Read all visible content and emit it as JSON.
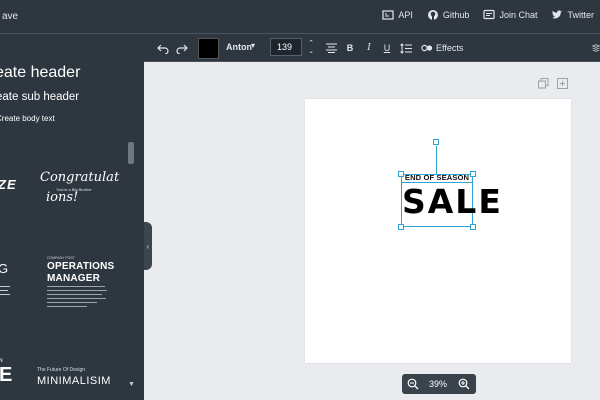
{
  "topbar": {
    "title_fragment": "ave",
    "links": [
      {
        "label": "API",
        "icon": "api-icon"
      },
      {
        "label": "Github",
        "icon": "github-icon"
      },
      {
        "label": "Join Chat",
        "icon": "chat-icon"
      },
      {
        "label": "Twitter",
        "icon": "twitter-icon"
      }
    ]
  },
  "sidebar": {
    "header_option": "eate header",
    "subheader_option": "eate sub header",
    "body_option": "Create body text",
    "templates": {
      "t1": "ZE",
      "t2_line1": "Congratulat",
      "t2_line2": "ions!",
      "t2_small": "You're a Big Brother",
      "t3": "G",
      "t4_small": "COMPANY POST",
      "t4_title1": "OPERATIONS",
      "t4_title2": "MANAGER",
      "t5": "E",
      "t5_small": "N",
      "t6_small": "The Future Of Design",
      "t6_title": "MINIMALISIM"
    }
  },
  "toolbar": {
    "text_color": "#000000",
    "font_name": "Anton",
    "font_size": "139",
    "effects_label": "Effects"
  },
  "canvas": {
    "small_text": "END OF SEASON",
    "big_text": "SALE",
    "zoom": "39%"
  },
  "colors": {
    "panel": "#2e3640",
    "workspace": "#e9ebee",
    "selection": "#2ea3d6"
  }
}
